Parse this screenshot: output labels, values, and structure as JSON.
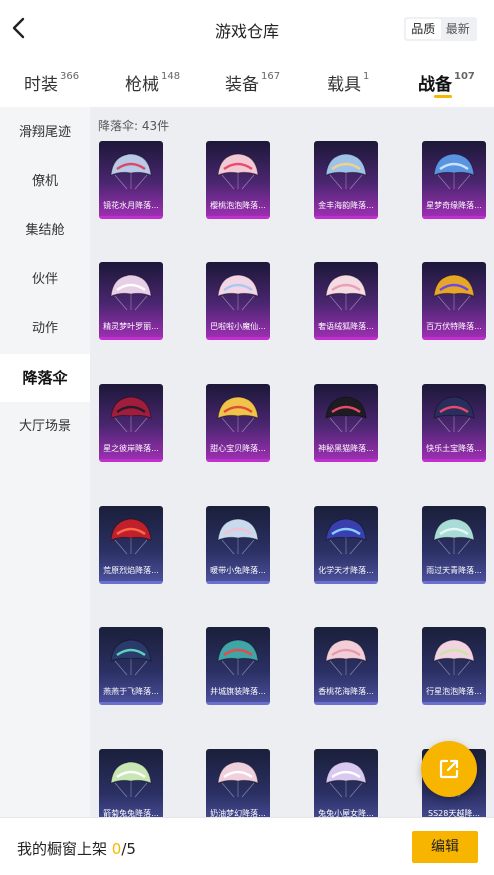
{
  "header": {
    "title": "游戏仓库",
    "sort_options": [
      "品质",
      "最新"
    ],
    "active_sort": 0
  },
  "tabs": [
    {
      "label": "时装",
      "count": "366"
    },
    {
      "label": "枪械",
      "count": "148"
    },
    {
      "label": "装备",
      "count": "167"
    },
    {
      "label": "载具",
      "count": "1"
    },
    {
      "label": "战备",
      "count": "107"
    }
  ],
  "active_tab": 4,
  "sidebar": {
    "items": [
      "滑翔尾迹",
      "僚机",
      "集结舱",
      "伙伴",
      "动作",
      "降落伞",
      "大厅场景"
    ],
    "active": 5
  },
  "content": {
    "count_label": "降落伞: 43件"
  },
  "items": [
    {
      "name": "镜花水月降落...",
      "tier": "purple",
      "color": "#b9c9e6",
      "accent": "#d64a6a",
      "icon": "parachute-canopy-icon"
    },
    {
      "name": "樱桃泡泡降落...",
      "tier": "purple",
      "color": "#f2c9d4",
      "accent": "#e84d6e",
      "icon": "parachute-canopy-icon"
    },
    {
      "name": "金丰海韵降落...",
      "tier": "purple",
      "color": "#9fc3e8",
      "accent": "#f1d28a",
      "icon": "parachute-canopy-icon"
    },
    {
      "name": "星梦奇缘降落...",
      "tier": "purple",
      "color": "#5a93e0",
      "accent": "#c9e3ff",
      "icon": "parachute-canopy-icon"
    },
    {
      "name": "精灵梦叶罗丽...",
      "tier": "purple",
      "color": "#e7cfe8",
      "accent": "#ffffff",
      "icon": "parachute-canopy-icon"
    },
    {
      "name": "巴啦啦小魔仙...",
      "tier": "purple",
      "color": "#f3d6e6",
      "accent": "#a9c9f0",
      "icon": "parachute-canopy-icon"
    },
    {
      "name": "奢语绒狐降落...",
      "tier": "purple",
      "color": "#f5dbe3",
      "accent": "#e9a0b5",
      "icon": "parachute-canopy-icon"
    },
    {
      "name": "百万伏特降落...",
      "tier": "purple",
      "color": "#e6a62a",
      "accent": "#6b4ae0",
      "icon": "parachute-canopy-icon"
    },
    {
      "name": "星之彼岸降落...",
      "tier": "purple",
      "color": "#a01e3c",
      "accent": "#2a1a2e",
      "icon": "parachute-canopy-icon"
    },
    {
      "name": "甜心宝贝降落...",
      "tier": "purple",
      "color": "#f0c34a",
      "accent": "#e04d3a",
      "icon": "parachute-canopy-icon"
    },
    {
      "name": "神秘黑猫降落...",
      "tier": "purple",
      "color": "#1c1c22",
      "accent": "#e84a6a",
      "icon": "parachute-canopy-icon"
    },
    {
      "name": "快乐土宝降落...",
      "tier": "purple",
      "color": "#2a2e5e",
      "accent": "#e84a6a",
      "icon": "parachute-canopy-icon"
    },
    {
      "name": "荒原烈焰降落...",
      "tier": "blue",
      "color": "#c0202c",
      "accent": "#ff6a4a",
      "icon": "parachute-canopy-icon"
    },
    {
      "name": "暖带小兔降落...",
      "tier": "blue",
      "color": "#c9d9ee",
      "accent": "#f2c2d2",
      "icon": "parachute-canopy-icon"
    },
    {
      "name": "化学天才降落...",
      "tier": "blue",
      "color": "#3a3fb0",
      "accent": "#8ad0ff",
      "icon": "parachute-canopy-icon"
    },
    {
      "name": "雨过天青降落...",
      "tier": "blue",
      "color": "#a9dcd6",
      "accent": "#e6f6f4",
      "icon": "parachute-canopy-icon"
    },
    {
      "name": "燕燕于飞降落...",
      "tier": "blue",
      "color": "#2a3a6a",
      "accent": "#5fd0c0",
      "icon": "parachute-canopy-icon"
    },
    {
      "name": "井城旗装降落...",
      "tier": "blue",
      "color": "#3fa5a6",
      "accent": "#e84a4a",
      "icon": "parachute-canopy-icon"
    },
    {
      "name": "香桃花海降落...",
      "tier": "blue",
      "color": "#f2cfd8",
      "accent": "#e79ab0",
      "icon": "parachute-canopy-icon"
    },
    {
      "name": "行星泡泡降落...",
      "tier": "blue",
      "color": "#f3d2e2",
      "accent": "#c8e8a0",
      "icon": "parachute-canopy-icon"
    },
    {
      "name": "箭菊兔兔降落...",
      "tier": "blue",
      "color": "#c9e6b5",
      "accent": "#ffffff",
      "icon": "parachute-canopy-icon"
    },
    {
      "name": "奶油梦幻降落...",
      "tier": "blue",
      "color": "#f0d0dc",
      "accent": "#ffffff",
      "icon": "parachute-canopy-icon"
    },
    {
      "name": "兔兔小屋女降...",
      "tier": "blue",
      "color": "#d9c9f0",
      "accent": "#ffffff",
      "icon": "parachute-canopy-icon"
    },
    {
      "name": "SS28天越降...",
      "tier": "blue",
      "color": "#e9d9c0",
      "accent": "#ffffff",
      "icon": "parachute-canopy-icon"
    }
  ],
  "bottom": {
    "shelf_label": "我的橱窗上架",
    "shelf_current": "0",
    "shelf_total": "/5",
    "edit_label": "编辑"
  },
  "colors": {
    "accent": "#f7b500",
    "purple_tier": "#c12fd0",
    "blue_tier": "#6a6fd0"
  }
}
